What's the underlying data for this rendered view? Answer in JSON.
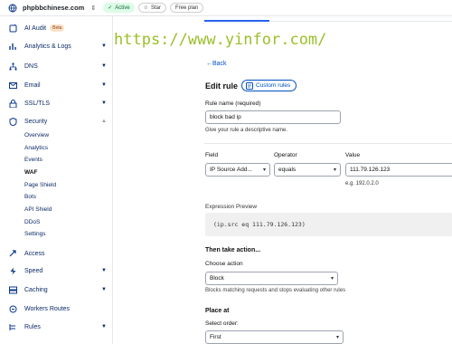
{
  "topbar": {
    "domain": "phpbbchinese.com",
    "status": "Active",
    "star_label": "Star",
    "plan_label": "Free plan"
  },
  "sidebar": {
    "items": [
      {
        "label": "AI Audit",
        "badge": "Beta",
        "icon": "sparkle-icon"
      },
      {
        "label": "Analytics & Logs",
        "icon": "chart-icon"
      },
      {
        "label": "DNS",
        "icon": "network-icon"
      },
      {
        "label": "Email",
        "icon": "mail-icon"
      },
      {
        "label": "SSL/TLS",
        "icon": "lock-icon"
      },
      {
        "label": "Security",
        "icon": "shield-icon"
      },
      {
        "label": "Access",
        "icon": "access-icon"
      },
      {
        "label": "Speed",
        "icon": "lightning-icon"
      },
      {
        "label": "Caching",
        "icon": "caching-icon"
      },
      {
        "label": "Workers Routes",
        "icon": "workers-icon"
      },
      {
        "label": "Rules",
        "icon": "rules-icon"
      }
    ],
    "security_sub": [
      "Overview",
      "Analytics",
      "Events",
      "WAF",
      "Page Shield",
      "Bots",
      "API Shield",
      "DDoS",
      "Settings"
    ]
  },
  "watermark": "https://www.yinfor.com/",
  "back": "Back",
  "page_title": "Edit rule",
  "chip": "Custom rules",
  "rule_name": {
    "label": "Rule name (required)",
    "value": "block bad ip",
    "hint": "Give your rule a descriptive name."
  },
  "condition": {
    "field_label": "Field",
    "field_value": "IP Source Add...",
    "operator_label": "Operator",
    "operator_value": "equals",
    "value_label": "Value",
    "value_value": "111.79.126.123",
    "value_hint": "e.g. 192.0.2.0"
  },
  "expression": {
    "label": "Expression Preview",
    "value": "(ip.src eq 111.79.126.123)"
  },
  "action": {
    "heading": "Then take action...",
    "label": "Choose action",
    "value": "Block",
    "hint": "Blocks matching requests and stops evaluating other rules"
  },
  "place": {
    "heading": "Place at",
    "label": "Select order:",
    "value": "First"
  },
  "colors": {
    "accent": "#0051c3",
    "active_bg": "#dcfce7",
    "watermark": "#9bbf2a"
  }
}
